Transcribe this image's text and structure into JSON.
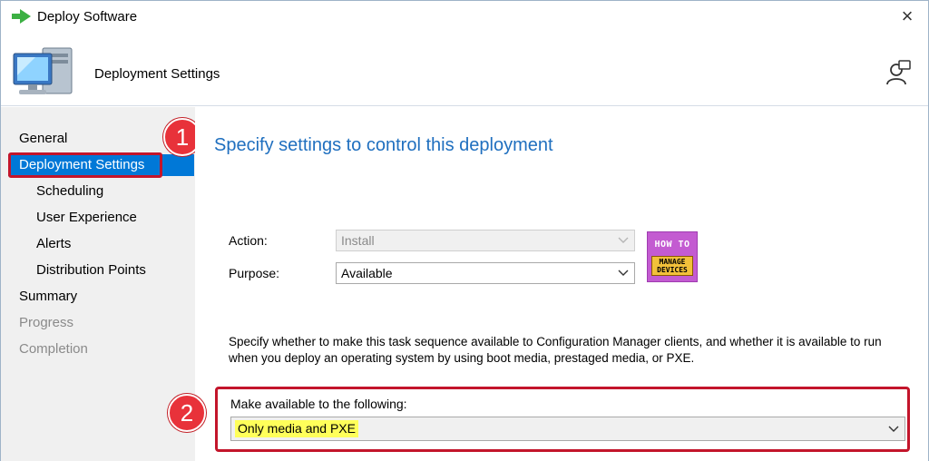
{
  "window": {
    "title": "Deploy Software",
    "close_glyph": "×",
    "title_icon": "green-arrow-icon",
    "close_icon": "close-icon"
  },
  "header": {
    "title": "Deployment Settings",
    "icon": "computer-icon",
    "help_icon": "user-help-icon"
  },
  "sidebar": {
    "items": [
      {
        "label": "General",
        "level": 0,
        "state": "normal"
      },
      {
        "label": "Deployment Settings",
        "level": 0,
        "state": "selected"
      },
      {
        "label": "Scheduling",
        "level": 1,
        "state": "normal"
      },
      {
        "label": "User Experience",
        "level": 1,
        "state": "normal"
      },
      {
        "label": "Alerts",
        "level": 1,
        "state": "normal"
      },
      {
        "label": "Distribution Points",
        "level": 1,
        "state": "normal"
      },
      {
        "label": "Summary",
        "level": 0,
        "state": "normal"
      },
      {
        "label": "Progress",
        "level": 0,
        "state": "disabled"
      },
      {
        "label": "Completion",
        "level": 0,
        "state": "disabled"
      }
    ]
  },
  "annotations": {
    "step1": "1",
    "step2": "2",
    "highlight_color": "#c3152b",
    "badge_color": "#e8323a"
  },
  "main": {
    "heading": "Specify settings to control this deployment",
    "action": {
      "label": "Action:",
      "value": "Install",
      "enabled": false
    },
    "purpose": {
      "label": "Purpose:",
      "value": "Available",
      "enabled": true
    },
    "logo": {
      "line1": "HOW TO",
      "line2": "MANAGE",
      "line3": "DEVICES"
    },
    "description": "Specify whether to make this task sequence available to Configuration Manager clients, and whether it is available to run when you deploy an operating system by using boot media, prestaged media, or PXE.",
    "make_available": {
      "label": "Make available to the following:",
      "value": "Only media and PXE"
    }
  },
  "colors": {
    "accent": "#0078d7",
    "heading": "#1f6fbf",
    "selection_highlight": "#ffff5a"
  }
}
